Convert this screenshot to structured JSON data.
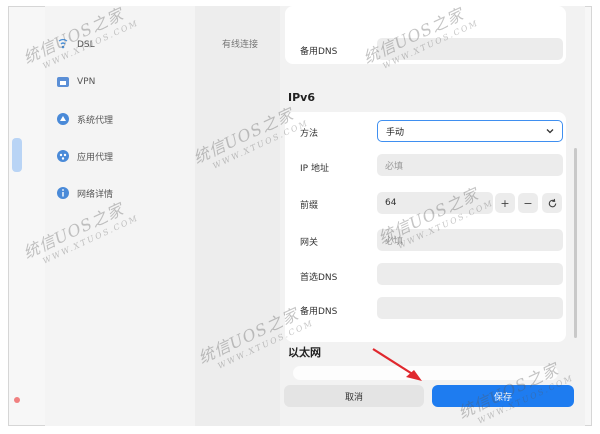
{
  "nav": {
    "items": [
      {
        "label": "DSL",
        "icon": "dsl-icon"
      },
      {
        "label": "VPN",
        "icon": "vpn-icon"
      },
      {
        "label": "系统代理",
        "icon": "system-proxy-icon"
      },
      {
        "label": "应用代理",
        "icon": "app-proxy-icon"
      },
      {
        "label": "网络详情",
        "icon": "network-details-icon"
      }
    ]
  },
  "mid": {
    "label": "有线连接"
  },
  "top_panel": {
    "backup_dns_label": "备用DNS"
  },
  "ipv6": {
    "title": "IPv6",
    "method_label": "方法",
    "method_value": "手动",
    "ip_label": "IP 地址",
    "ip_placeholder": "必填",
    "prefix_label": "前缀",
    "prefix_value": "64",
    "plus": "+",
    "minus": "−",
    "gateway_label": "网关",
    "gateway_placeholder": "必填",
    "primary_dns_label": "首选DNS",
    "backup_dns_label": "备用DNS"
  },
  "ethernet": {
    "title": "以太网"
  },
  "footer": {
    "cancel_label": "取消",
    "save_label": "保存"
  },
  "watermark": {
    "text": "统信UOS之家",
    "url": "WWW.XTUOS.COM"
  },
  "colors": {
    "accent": "#1e7cf0",
    "select_border": "#3f8ff0",
    "annotation_arrow": "#e0282e"
  }
}
